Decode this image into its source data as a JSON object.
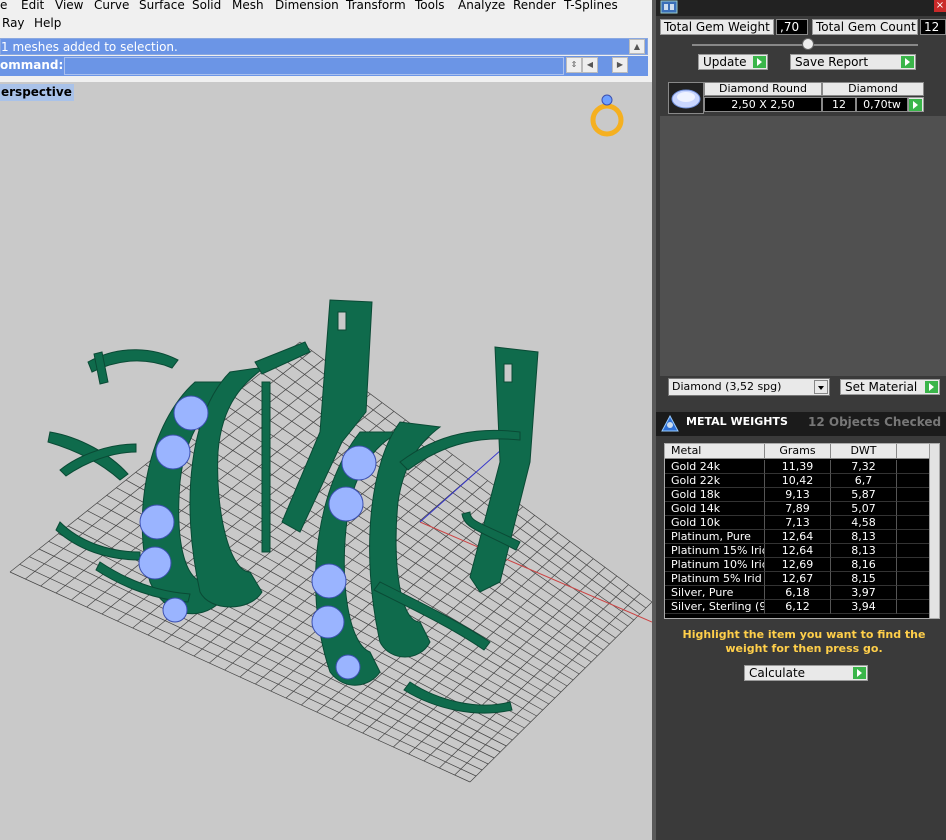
{
  "menu": {
    "row1": [
      "e",
      "Edit",
      "View",
      "Curve",
      "Surface",
      "Solid",
      "Mesh",
      "Dimension",
      "Transform",
      "Tools",
      "Analyze",
      "Render",
      "T-Splines"
    ],
    "row2": [
      "Ray",
      "Help"
    ]
  },
  "command": {
    "history": "1 meshes added to selection.",
    "prompt_label": "ommand:",
    "input_value": ""
  },
  "viewport": {
    "title": "erspective"
  },
  "panel": {
    "total_gem_weight_label": "Total Gem Weight",
    "total_gem_weight_value": ",70",
    "total_gem_count_label": "Total Gem Count",
    "total_gem_count_value": "12",
    "update_label": "Update",
    "save_report_label": "Save Report",
    "gem_table": {
      "headers": [
        "Diamond Round",
        "Diamond"
      ],
      "row": {
        "size": "2,50 X 2,50",
        "count": "12",
        "weight": "0,70tw"
      }
    },
    "material_select": "Diamond   (3,52 spg)",
    "set_material_label": "Set Material",
    "metal_weights": {
      "title": "METAL WEIGHTS",
      "objects_checked": "12 Objects Checked",
      "headers": [
        "Metal",
        "Grams",
        "DWT"
      ],
      "rows": [
        [
          "Gold 24k",
          "11,39",
          "7,32"
        ],
        [
          "Gold 22k",
          "10,42",
          "6,7"
        ],
        [
          "Gold 18k",
          "9,13",
          "5,87"
        ],
        [
          "Gold 14k",
          "7,89",
          "5,07"
        ],
        [
          "Gold 10k",
          "7,13",
          "4,58"
        ],
        [
          "Platinum, Pure",
          "12,64",
          "8,13"
        ],
        [
          "Platinum 15% Irid",
          "12,64",
          "8,13"
        ],
        [
          "Platinum 10% Irid",
          "12,69",
          "8,16"
        ],
        [
          "Platinum 5% Irid",
          "12,67",
          "8,15"
        ],
        [
          "Silver, Pure",
          "6,18",
          "3,97"
        ],
        [
          "Silver, Sterling (9...",
          "6,12",
          "3,94"
        ]
      ]
    },
    "hint": "Highlight the item you want to find the weight for then press go.",
    "calculate_label": "Calculate"
  },
  "colors": {
    "jewel_green": "#0f6b4c",
    "gem_blue": "#9ab4ff",
    "command_blue": "#6b95e6",
    "panel_bg": "#3a3a3a"
  }
}
